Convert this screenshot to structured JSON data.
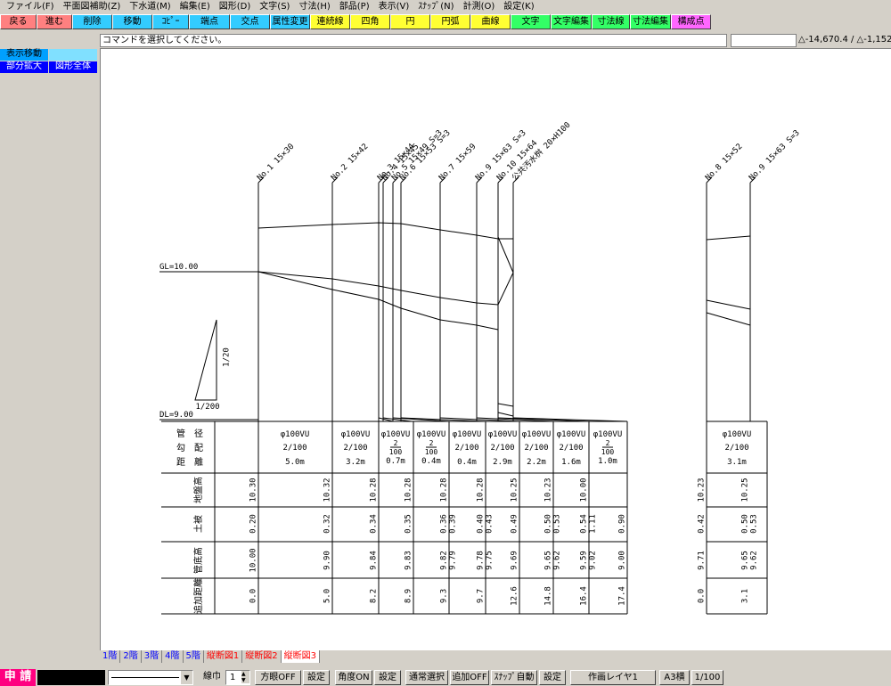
{
  "menu": [
    "ファイル(F)",
    "平面図補助(Z)",
    "下水道(M)",
    "編集(E)",
    "図形(D)",
    "文字(S)",
    "寸法(H)",
    "部品(P)",
    "表示(V)",
    "ｽﾅｯﾌﾟ(N)",
    "計測(O)",
    "設定(K)"
  ],
  "commands": [
    {
      "label": "戻る",
      "color": "#ff8080"
    },
    {
      "label": "進む",
      "color": "#ff8080"
    },
    {
      "label": "削除",
      "color": "#33ccff"
    },
    {
      "label": "移動",
      "color": "#33ccff"
    },
    {
      "label": "ｺﾋﾟｰ",
      "color": "#33ccff"
    },
    {
      "label": "端点",
      "color": "#33ccff"
    },
    {
      "label": "交点",
      "color": "#33ccff"
    },
    {
      "label": "属性変更",
      "color": "#33ccff"
    },
    {
      "label": "連続線",
      "color": "#ffff33"
    },
    {
      "label": "四角",
      "color": "#ffff33"
    },
    {
      "label": "円",
      "color": "#ffff33"
    },
    {
      "label": "円弧",
      "color": "#ffff33"
    },
    {
      "label": "曲線",
      "color": "#ffff33"
    },
    {
      "label": "文字",
      "color": "#33ff66"
    },
    {
      "label": "文字編集",
      "color": "#33ff66"
    },
    {
      "label": "寸法線",
      "color": "#33ff66"
    },
    {
      "label": "寸法編集",
      "color": "#33ff66"
    },
    {
      "label": "構成点",
      "color": "#ff66ff"
    }
  ],
  "prompt": "コマンドを選択してください。",
  "coords": "△-14,670.4 / △-1,152.3",
  "left_panel": {
    "move_view": "表示移動",
    "zoom_part": "部分拡大",
    "zoom_all": "図形全体"
  },
  "drawing": {
    "gl_label": "GL=10.00",
    "dl_label": "DL=9.00",
    "scale_v": "1/20",
    "scale_h": "1/200",
    "manholes": [
      "No.1 15×30",
      "No.2 15×42",
      "No.3 15×44",
      "No.4 15×45",
      "No.5 15×49 S=3",
      "No.6 15×53 S=3",
      "No.7 15×59",
      "No.9 15×63 S=3",
      "No.10 15×64",
      "公共汚水桝 20×H100",
      "No.8 15×52",
      "No.9 15×63 S=3"
    ],
    "row_headers": {
      "r1": [
        "管",
        "径"
      ],
      "r2": [
        "勾",
        "配"
      ],
      "r3": [
        "距",
        "離"
      ],
      "ground": "地盤高",
      "cover": "土被",
      "invert": "管底高",
      "cumdist": "追加距離"
    },
    "pipe_spec": "φ100VU",
    "segments": [
      {
        "grade": "2/100",
        "dist": "5.0m",
        "stacked": false
      },
      {
        "grade": "2/100",
        "dist": "3.2m",
        "stacked": false
      },
      {
        "grade": "2/100",
        "dist": "0.7m",
        "stacked": true
      },
      {
        "grade": "2/100",
        "dist": "0.4m",
        "stacked": true
      },
      {
        "grade": "2/100",
        "dist": "0.4m",
        "stacked": false
      },
      {
        "grade": "2/100",
        "dist": "2.9m",
        "stacked": false
      },
      {
        "grade": "2/100",
        "dist": "2.2m",
        "stacked": false
      },
      {
        "grade": "2/100",
        "dist": "1.6m",
        "stacked": false
      },
      {
        "grade": "2/100",
        "dist": "1.0m",
        "stacked": true
      },
      {
        "grade": "2/100",
        "dist": "3.1m",
        "stacked": false
      }
    ],
    "ground_heights": [
      "10.30",
      "10.32",
      "10.28",
      "10.28",
      "10.28",
      "10.28",
      "10.25",
      "10.23",
      "10.00",
      "10.23",
      "10.25"
    ],
    "cover_values": [
      [
        "0.20"
      ],
      [
        "0.32"
      ],
      [
        "0.34"
      ],
      [
        "0.35"
      ],
      [
        "0.36",
        "0.39"
      ],
      [
        "0.40",
        "0.43"
      ],
      [
        "0.49"
      ],
      [
        "0.50",
        "0.53"
      ],
      [
        "0.54",
        "1.11"
      ],
      [
        "0.90"
      ],
      [
        "0.42"
      ],
      [
        "0.50",
        "0.53"
      ]
    ],
    "invert_values": [
      [
        "10.00"
      ],
      [
        "9.90"
      ],
      [
        "9.84"
      ],
      [
        "9.83"
      ],
      [
        "9.82",
        "9.79"
      ],
      [
        "9.78",
        "9.75"
      ],
      [
        "9.69"
      ],
      [
        "9.65",
        "9.62"
      ],
      [
        "9.59",
        "9.02"
      ],
      [
        "9.00"
      ],
      [
        "9.71"
      ],
      [
        "9.65",
        "9.62"
      ]
    ],
    "cumulative": [
      "0.0",
      "5.0",
      "8.2",
      "8.9",
      "9.3",
      "9.7",
      "12.6",
      "14.8",
      "16.4",
      "17.4",
      "0.0",
      "3.1"
    ]
  },
  "tabs": [
    {
      "label": "1階",
      "color": "blue"
    },
    {
      "label": "2階",
      "color": "blue"
    },
    {
      "label": "3階",
      "color": "blue"
    },
    {
      "label": "4階",
      "color": "blue"
    },
    {
      "label": "5階",
      "color": "blue"
    },
    {
      "label": "縦断図1",
      "color": "red"
    },
    {
      "label": "縦断図2",
      "color": "red"
    },
    {
      "label": "縦断図3",
      "color": "red",
      "active": true
    }
  ],
  "status": {
    "app": "申 請",
    "line_width_label": "線巾",
    "line_width_value": "1",
    "grid": "方眼OFF",
    "setting": "設定",
    "angle": "角度ON",
    "select_mode": "通常選択",
    "append": "追加OFF",
    "snap": "ｽﾅｯﾌﾟ自動",
    "layer": "作画レイヤ1",
    "paper": "A3横",
    "scale": "1/100"
  }
}
